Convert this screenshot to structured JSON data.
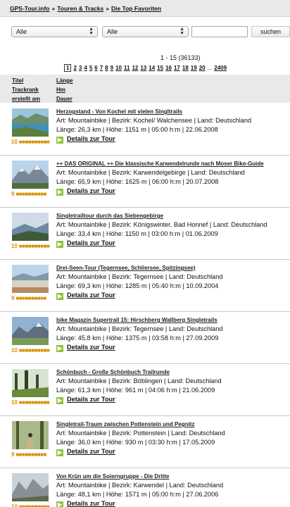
{
  "breadcrumb": {
    "home": "GPS-Tour.info",
    "section": "Touren & Tracks",
    "current": "Die Top Favoriten",
    "sep": "»"
  },
  "filters": {
    "select1": "Alle",
    "select2": "Alle",
    "search_value": "",
    "search_label": "suchen"
  },
  "results": {
    "range": "1 - 15 (36133)",
    "pages": [
      "1",
      "2",
      "3",
      "4",
      "5",
      "6",
      "7",
      "8",
      "9",
      "10",
      "11",
      "12",
      "13",
      "14",
      "15",
      "16",
      "17",
      "18",
      "19",
      "20"
    ],
    "current_page": "1",
    "ellipsis": "...",
    "last_page": "2409"
  },
  "sort": {
    "title": "Titel",
    "length": "Länge",
    "trackrank": "Trackrank",
    "hm": "Hm",
    "created": "erstellt am",
    "duration": "Dauer"
  },
  "details_label": "Details zur Tour",
  "rating_dots": "■■■■■■■■■■",
  "tours": [
    {
      "title": "Herzogstand - Von Kochel mit vielen Singltrails",
      "info": "Art: Mountainbike | Bezirk: Kochel/ Walchensee | Land: Deutschland",
      "stats": "Länge: 26,3 km | Höhe: 1151 m | 05:00 h:m | 22.06.2008",
      "rating": "10",
      "thumb": "lake"
    },
    {
      "title": "++ DAS ORIGINAL ++ Die klassische Karwendelrunde nach Moser Bike-Guide",
      "info": "Art: Mountainbike | Bezirk: Karwendelgebirge | Land: Deutschland",
      "stats": "Länge: 65,9 km | Höhe: 1625 m | 06:00 h:m | 20.07.2008",
      "rating": "9",
      "thumb": "mountain"
    },
    {
      "title": "Singletrailtour durch das Siebengebirge",
      "info": "Art: Mountainbike | Bezirk: Königswinter, Bad Honnef | Land: Deutschland",
      "stats": "Länge: 33,4 km | Höhe: 1150 m | 03:00 h:m | 01.06.2009",
      "rating": "10",
      "thumb": "valley"
    },
    {
      "title": "Drei-Seen-Tour (Tegernsee, Schliersee, Spitzingsee)",
      "info": "Art: Mountainbike | Bezirk: Tegernsee | Land: Deutschland",
      "stats": "Länge: 69,3 km | Höhe: 1285 m | 05:40 h:m | 10.09.2004",
      "rating": "9",
      "thumb": "shore"
    },
    {
      "title": "bike Magazin Supertrail 15: Hirschberg Wallberg Singletrails",
      "info": "Art: Mountainbike | Bezirk: Tegernsee | Land: Deutschland",
      "stats": "Länge: 45,8 km | Höhe: 1375 m | 03:58 h:m | 27.09.2009",
      "rating": "10",
      "thumb": "alpine"
    },
    {
      "title": "Schönbuch - Große Schönbuch Trailrunde",
      "info": "Art: Mountainbike | Bezirk: Böblingen | Land: Deutschland",
      "stats": "Länge: 61,3 km | Höhe: 961 m | 04:06 h:m | 21.06.2009",
      "rating": "10",
      "thumb": "forest"
    },
    {
      "title": "Singletrail-Traum zwischen Pottenstein und Pegnitz",
      "info": "Art: Mountainbike | Bezirk: Pottenstein | Land: Deutschland",
      "stats": "Länge: 36,0 km | Höhe: 930 m | 03:30 h:m | 17.05.2009",
      "rating": "9",
      "thumb": "trail"
    },
    {
      "title": "Von Krün um die Soierngruppe - Die Dritte",
      "info": "Art: Mountainbike | Bezirk: Karwendel | Land: Deutschland",
      "stats": "Länge: 48,1 km | Höhe: 1571 m | 05:00 h:m | 27.06.2006",
      "rating": "10",
      "thumb": "rocks"
    }
  ],
  "colors": {
    "rating": "#d89000",
    "details_arrow": "#8fc33a",
    "bar": "#e9e9e9"
  }
}
